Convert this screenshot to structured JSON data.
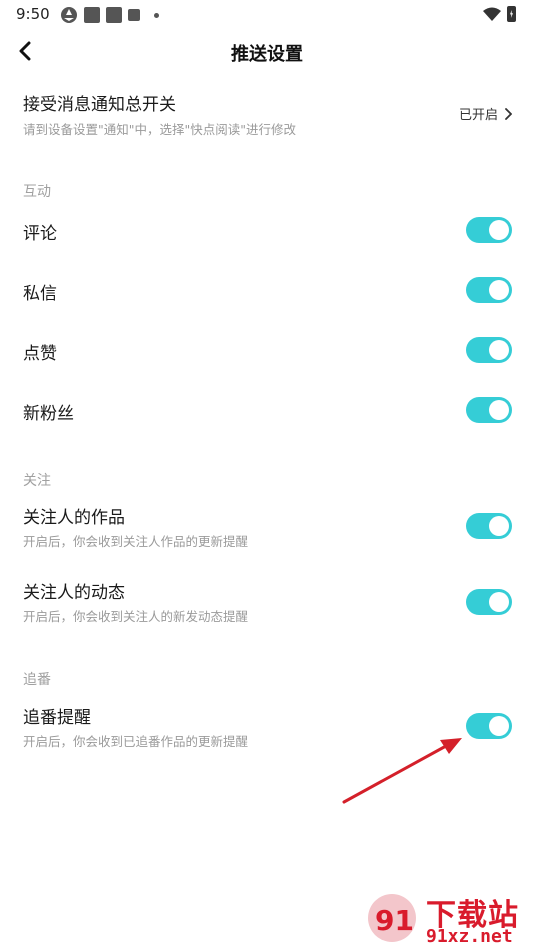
{
  "status_bar": {
    "time": "9:50",
    "icons": [
      "aperture-icon",
      "app-square-icon",
      "app-square-icon",
      "app-square-icon",
      "more-dot-icon"
    ],
    "right_icons": [
      "wifi-icon",
      "battery-charging-icon"
    ]
  },
  "header": {
    "title": "推送设置",
    "back_icon": "chevron-left-icon"
  },
  "master_switch": {
    "title": "接受消息通知总开关",
    "subtitle": "请到设备设置\"通知\"中，选择\"快点阅读\"进行修改",
    "status": "已开启"
  },
  "sections": [
    {
      "label": "互动",
      "items": [
        {
          "title": "评论",
          "on": true
        },
        {
          "title": "私信",
          "on": true
        },
        {
          "title": "点赞",
          "on": true
        },
        {
          "title": "新粉丝",
          "on": true
        }
      ]
    },
    {
      "label": "关注",
      "items": [
        {
          "title": "关注人的作品",
          "subtitle": "开启后，你会收到关注人作品的更新提醒",
          "on": true
        },
        {
          "title": "关注人的动态",
          "subtitle": "开启后，你会收到关注人的新发动态提醒",
          "on": true
        }
      ]
    },
    {
      "label": "追番",
      "items": [
        {
          "title": "追番提醒",
          "subtitle": "开启后，你会收到已追番作品的更新提醒",
          "on": true
        }
      ]
    }
  ],
  "colors": {
    "toggle_on": "#35cdd6",
    "annotation_arrow": "#d4202a"
  },
  "watermark": {
    "text": "下载站",
    "domain": "91xz.net"
  }
}
